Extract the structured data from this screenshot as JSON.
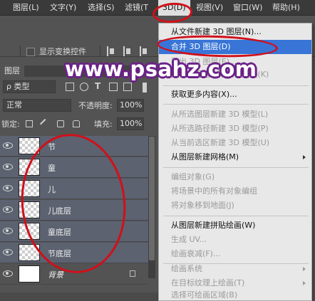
{
  "menubar": {
    "items": [
      {
        "label": "图层(L)"
      },
      {
        "label": "文字(Y)"
      },
      {
        "label": "选择(S)"
      },
      {
        "label": "滤镜(T"
      },
      {
        "label": "3D(D)"
      },
      {
        "label": "视图(V)"
      },
      {
        "label": "窗口(W)"
      },
      {
        "label": "帮助(H)"
      }
    ]
  },
  "options": {
    "show_transform_label": "显示变换控件"
  },
  "layers_panel": {
    "tab_label": "图层",
    "filter_kind": "ρ 类型",
    "blend_mode": "正常",
    "opacity_label": "不透明度:",
    "opacity_value": "100%",
    "lock_label": "锁定:",
    "fill_label": "填充:",
    "fill_value": "100%",
    "layers": [
      {
        "name": "节"
      },
      {
        "name": "童"
      },
      {
        "name": "儿"
      },
      {
        "name": "儿底层"
      },
      {
        "name": "童底层"
      },
      {
        "name": "节底层"
      },
      {
        "name": "背景"
      }
    ]
  },
  "menu_3d": {
    "items": [
      {
        "label": "从文件新建 3D 图层(N)..."
      },
      {
        "label": "合并 3D 图层(D)"
      },
      {
        "label": "导出 3D 图层(E)..."
      },
      {
        "label": "从 3D 图层生成工作路径(K)"
      },
      {
        "label": "获取更多内容(X)..."
      },
      {
        "label": "从所选图层新建 3D 模型(L)"
      },
      {
        "label": "从所选路径新建 3D 模型(P)"
      },
      {
        "label": "从当前选区新建 3D 模型(U)"
      },
      {
        "label": "从图层新建网格(M)"
      },
      {
        "label": "编组对象(G)"
      },
      {
        "label": "将场景中的所有对象编组"
      },
      {
        "label": "将对象移到地面(J)"
      },
      {
        "label": "从图层新建拼贴绘画(W)"
      },
      {
        "label": "生成 UV..."
      },
      {
        "label": "绘画衰减(F)..."
      },
      {
        "label": "绘画系统"
      },
      {
        "label": "在目标纹理上绘画(T)"
      },
      {
        "label": "选择可绘画区域(B)"
      }
    ]
  },
  "watermark": {
    "text": "www.psahz.com"
  },
  "colors": {
    "highlight": "#3875d7",
    "annotation_ring": "#d0101a",
    "watermark_outline": "#6b2287"
  }
}
